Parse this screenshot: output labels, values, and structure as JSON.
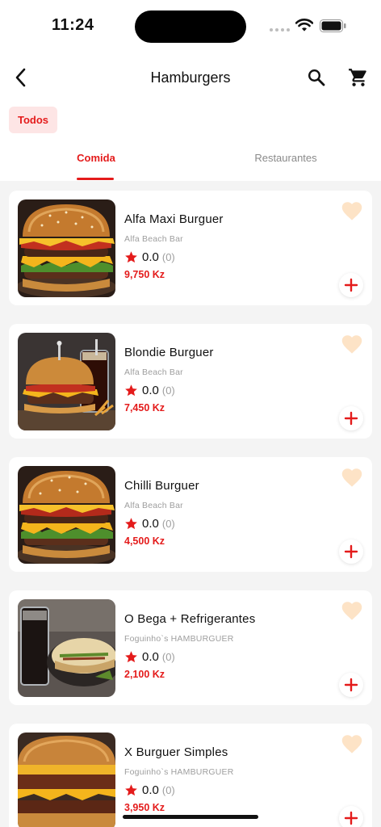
{
  "status_bar": {
    "time": "11:24",
    "icons": [
      "cellular-signal-icon",
      "wifi-icon",
      "battery-icon"
    ]
  },
  "header": {
    "title": "Hamburgers",
    "icons": {
      "back": "chevron-left-icon",
      "search": "search-icon",
      "cart": "shopping-cart-icon"
    }
  },
  "filters": {
    "selected": "Todos"
  },
  "tabs": [
    {
      "label": "Comida",
      "active": true
    },
    {
      "label": "Restaurantes",
      "active": false
    }
  ],
  "products": [
    {
      "name": "Alfa Maxi Burguer",
      "restaurant": "Alfa Beach Bar",
      "rating": "0.0",
      "reviews": "(0)",
      "price": "9,750 Kz"
    },
    {
      "name": "Blondie Burguer",
      "restaurant": "Alfa Beach Bar",
      "rating": "0.0",
      "reviews": "(0)",
      "price": "7,450 Kz"
    },
    {
      "name": "Chilli Burguer",
      "restaurant": "Alfa Beach Bar",
      "rating": "0.0",
      "reviews": "(0)",
      "price": "4,500 Kz"
    },
    {
      "name": "O Bega + Refrigerantes",
      "restaurant": "Foguinho`s HAMBURGUER",
      "rating": "0.0",
      "reviews": "(0)",
      "price": "2,100 Kz"
    },
    {
      "name": "X Burguer Simples",
      "restaurant": "Foguinho`s HAMBURGUER",
      "rating": "0.0",
      "reviews": "(0)",
      "price": "3,950 Kz"
    }
  ],
  "colors": {
    "accent": "#e41b1b",
    "chip_background": "#fde5e5",
    "heart": "#fde3c6",
    "background": "#f4f4f4"
  }
}
